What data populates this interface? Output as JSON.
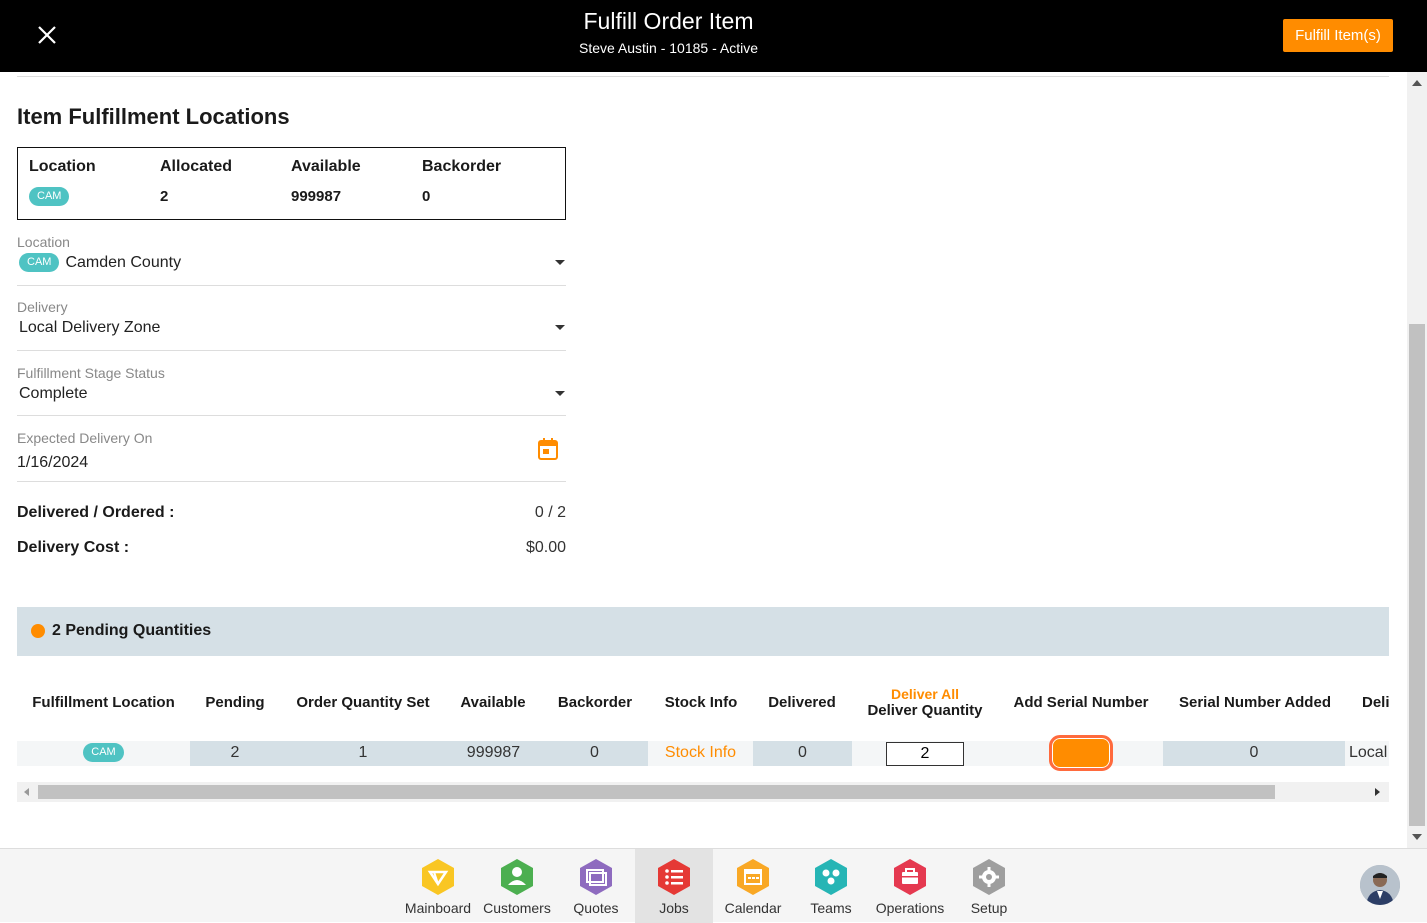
{
  "header": {
    "title": "Fulfill Order Item",
    "subtitle": "Steve Austin - 10185 - Active",
    "fulfill_button": "Fulfill Item(s)"
  },
  "section_title": "Item Fulfillment Locations",
  "summary": {
    "headers": [
      "Location",
      "Allocated",
      "Available",
      "Backorder"
    ],
    "location_badge": "CAM",
    "allocated": "2",
    "available": "999987",
    "backorder": "0"
  },
  "form": {
    "location": {
      "label": "Location",
      "badge": "CAM",
      "value": "Camden County"
    },
    "delivery": {
      "label": "Delivery",
      "value": "Local Delivery Zone"
    },
    "stage_status": {
      "label": "Fulfillment Stage Status",
      "value": "Complete"
    },
    "expected_delivery": {
      "label": "Expected Delivery On",
      "value": "1/16/2024"
    }
  },
  "totals": {
    "delivered_ordered_label": "Delivered / Ordered :",
    "delivered_ordered_value": "0 / 2",
    "delivery_cost_label": "Delivery Cost :",
    "delivery_cost_value": "$0.00"
  },
  "pending": {
    "text": "2 Pending Quantities",
    "dot_color": "#ff8c00"
  },
  "table": {
    "headers": {
      "fulfillment_location": "Fulfillment Location",
      "pending": "Pending",
      "order_quantity_set": "Order Quantity Set",
      "available": "Available",
      "backorder": "Backorder",
      "stock_info": "Stock Info",
      "delivered": "Delivered",
      "deliver_all": "Deliver All",
      "deliver_quantity": "Deliver Quantity",
      "add_serial_number": "Add Serial Number",
      "serial_number_added": "Serial Number Added",
      "delivery_truncated": "Deli"
    },
    "row": {
      "location_badge": "CAM",
      "pending": "2",
      "order_quantity_set": "1",
      "available": "999987",
      "backorder": "0",
      "stock_info": "Stock Info",
      "delivered": "0",
      "deliver_quantity": "2",
      "serial_number_added": "0",
      "delivery_truncated": "Local"
    }
  },
  "bottom_nav": {
    "items": [
      {
        "label": "Mainboard",
        "icon": "mainboard-icon",
        "color": "#f9c623"
      },
      {
        "label": "Customers",
        "icon": "customers-icon",
        "color": "#4caf50"
      },
      {
        "label": "Quotes",
        "icon": "quotes-icon",
        "color": "#8e6bbf"
      },
      {
        "label": "Jobs",
        "icon": "jobs-icon",
        "color": "#e53935"
      },
      {
        "label": "Calendar",
        "icon": "calendar-icon",
        "color": "#f9a825"
      },
      {
        "label": "Teams",
        "icon": "teams-icon",
        "color": "#26b5b5"
      },
      {
        "label": "Operations",
        "icon": "operations-icon",
        "color": "#e53950"
      },
      {
        "label": "Setup",
        "icon": "setup-icon",
        "color": "#9e9e9e"
      }
    ],
    "active": "Jobs"
  },
  "colors": {
    "accent": "#ff8c00",
    "badge": "#4fc3c3",
    "band": "#d5e0e6"
  }
}
